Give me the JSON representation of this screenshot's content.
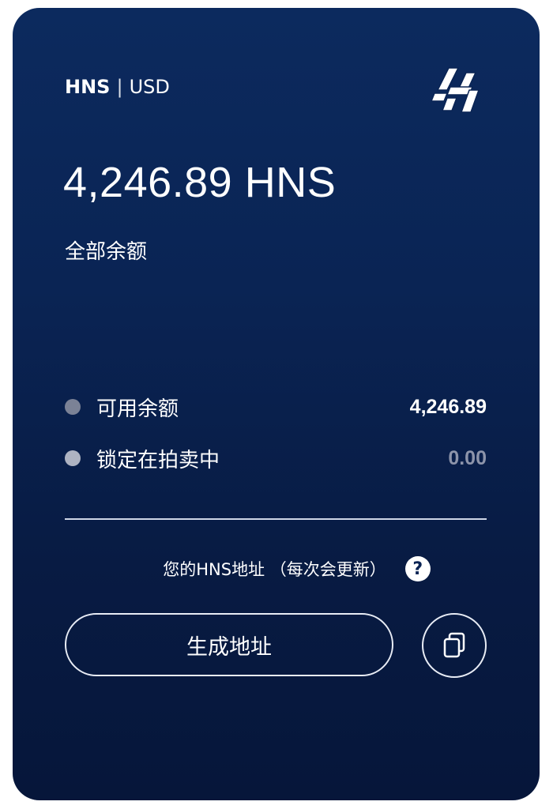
{
  "header": {
    "currency_active": "HNS",
    "separator": "|",
    "currency_inactive": "USD",
    "logo_icon": "handshake-logo-icon"
  },
  "balance": {
    "amount": "4,246.89 HNS",
    "label": "全部余额"
  },
  "breakdown": [
    {
      "label": "可用余额",
      "value": "4,246.89",
      "dot_color": "#7b8296"
    },
    {
      "label": "锁定在拍卖中",
      "value": "0.00",
      "dot_color": "#aeb3c2"
    }
  ],
  "address": {
    "label": "您的HNS地址 （每次会更新）",
    "help_icon": "question-circle-icon",
    "help_glyph": "?"
  },
  "actions": {
    "generate_label": "生成地址",
    "copy_icon": "copy-icon"
  },
  "colors": {
    "card_background": "#0a2454",
    "text_primary": "#ffffff",
    "text_muted": "#8d94aa"
  }
}
